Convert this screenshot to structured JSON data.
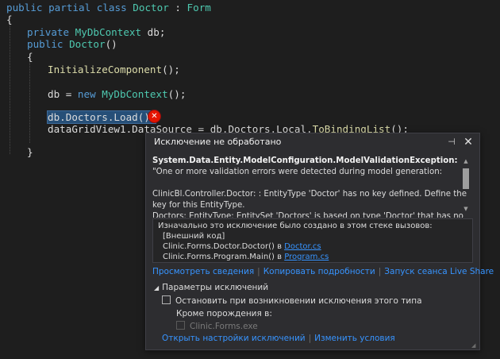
{
  "code": {
    "line1": {
      "kw1": "public",
      "kw2": "partial",
      "kw3": "class",
      "name": "Doctor",
      "colon": " : ",
      "base": "Form"
    },
    "line2": "{",
    "line3": {
      "kw": "private",
      "type": "MyDbContext",
      "rest": " db;"
    },
    "line4": {
      "kw": "public",
      "fn": "Doctor",
      "rest": "()"
    },
    "line5": "{",
    "line6": {
      "fn": "InitializeComponent",
      "rest": "();"
    },
    "line7": {
      "pre": "db = ",
      "kw": "new",
      "type": "MyDbContext",
      "rest": "();"
    },
    "line8": {
      "text": "db.Doctors.Load();"
    },
    "line9": {
      "pre": "dataGridView1.DataSource = db.Doctors.Local.",
      "fn": "ToBindingList",
      "rest": "();"
    },
    "line10": "}"
  },
  "popup": {
    "title": "Исключение не обработано",
    "pin_glyph": "⊣",
    "close_glyph": "✕",
    "exception_type": "System.Data.Entity.ModelConfiguration.ModelValidationException:",
    "exception_message": " \"One or more validation errors were detected during model generation:",
    "exception_details": "ClinicBl.Controller.Doctor: : EntityType 'Doctor' has no key defined. Define the key for this EntityType.",
    "exception_cutoff": "Doctors: EntityType: EntitySet 'Doctors' is based on type 'Doctor' that has no",
    "stack": {
      "header": "Изначально это исключение было создано в этом стеке вызовов:",
      "frames": [
        {
          "text": "[Внешний код]",
          "file": ""
        },
        {
          "text": "Clinic.Forms.Doctor.Doctor() в ",
          "file": "Doctor.cs"
        },
        {
          "text": "Clinic.Forms.Program.Main() в ",
          "file": "Program.cs"
        }
      ]
    },
    "links": {
      "view_details": "Просмотреть сведения",
      "copy_details": "Копировать подробности",
      "live_share": "Запуск сеанса Live Share"
    },
    "settings": {
      "header": "Параметры исключений",
      "break_when_thrown": "Остановить при возникновении исключения этого типа",
      "except_when_thrown_from": "Кроме порождения в:",
      "module": "Clinic.Forms.exe"
    },
    "bottom_links": {
      "open_settings": "Открыть настройки исключений",
      "edit_conditions": "Изменить условия"
    }
  }
}
